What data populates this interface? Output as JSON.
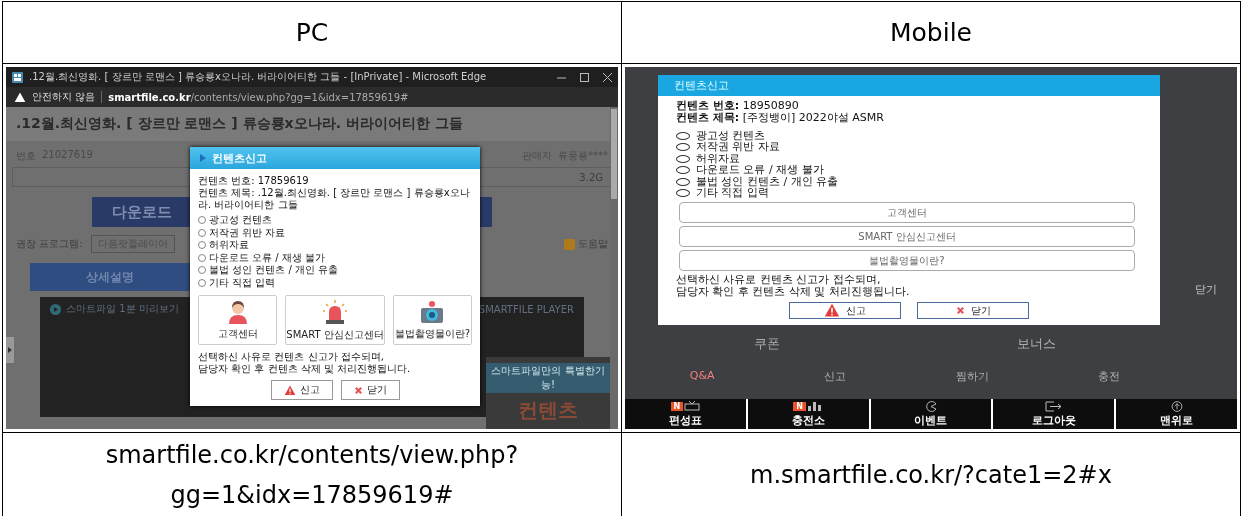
{
  "columns": [
    {
      "heading": "PC"
    },
    {
      "heading": "Mobile"
    }
  ],
  "pc": {
    "window_title": ".12월.최신영화. [ 장르만 로맨스 ] 류승룡x오나라. 버라이어티한 그들 - [InPrivate] - Microsoft Edge",
    "address_bar": {
      "warning": "안전하지 않음",
      "host": "smartfile.co.kr",
      "path": "/contents/view.php?gg=1&idx=17859619#"
    },
    "page": {
      "title": ".12월.최신영화. [ 장르만 로맨스 ] 류승룡x오나라. 버라이어티한 그들",
      "number_label": "번호",
      "number": "21027619",
      "seller_label": "판매자",
      "seller": "류풍룡****",
      "file_size": "3.2G",
      "download": "다운로드",
      "recommended_label": "권장 프로그램:",
      "player": "다음팟플레이어",
      "help": "도움말",
      "detail_tab": "상세설명",
      "preview_title": "스마트파일 1분 미리보기",
      "player_label": "SMARTFILE PLAYER",
      "promo_ribbon": "스마트파일만의 특별한기능!",
      "promo_title": "컨텐츠"
    },
    "dialog": {
      "title": "컨텐츠신고",
      "info": [
        "컨텐츠 번호: 17859619",
        "컨텐츠 제목: .12월.최신영화. [ 장르만 로맨스 ] 류승룡x오나라. 버라이어티한 그들"
      ],
      "reasons": [
        {
          "label": "광고성 컨텐츠",
          "selected": false
        },
        {
          "label": "저작권 위반 자료",
          "selected": false
        },
        {
          "label": "허위자료",
          "selected": false
        },
        {
          "label": "다운로드 오류 / 재생 불가",
          "selected": false
        },
        {
          "label": "불법 성인 컨텐츠 / 개인 유출",
          "selected": false
        },
        {
          "label": "기타 직접 입력",
          "selected": false
        }
      ],
      "links": [
        {
          "label": "고객센터",
          "kind": "person"
        },
        {
          "label": "SMART 안심신고센터",
          "kind": "siren"
        },
        {
          "label": "불법촬영물이란?",
          "kind": "camera"
        }
      ],
      "notice": [
        "선택하신 사유로 컨텐츠 신고가 접수되며,",
        "담당자 확인 후 컨텐츠 삭제 및 처리진행됩니다."
      ],
      "actions": [
        {
          "label": "신고",
          "kind": "report"
        },
        {
          "label": "닫기",
          "kind": "close"
        }
      ]
    }
  },
  "mobile": {
    "page": {
      "coupon": "쿠폰",
      "bonus": "보너스",
      "qna": "Q&A",
      "report": "신고",
      "favorite": "찜하기",
      "charge": "충전",
      "close": "닫기"
    },
    "dialog": {
      "title": "컨텐츠신고",
      "info": [
        "**컨텐츠 번호:** 18950890",
        "**컨텐츠 제목:** [주정뱅이] 2022야설 ASMR"
      ],
      "reasons": [
        {
          "label": "광고성 컨텐츠",
          "selected": false
        },
        {
          "label": "저작권 위반 자료",
          "selected": false
        },
        {
          "label": "허위자료",
          "selected": false
        },
        {
          "label": "다운로드 오류 / 재생 불가",
          "selected": false
        },
        {
          "label": "불법 성인 컨텐츠 / 개인 유출",
          "selected": false
        },
        {
          "label": "기타 직접 입력",
          "selected": false
        }
      ],
      "links": [
        {
          "label": "고객센터"
        },
        {
          "label": "SMART 안심신고센터"
        },
        {
          "label": "불법촬영물이란?"
        }
      ],
      "notice": [
        "선택하신 사유로 컨텐츠 신고가 접수되며,",
        "담당자 확인 후 컨텐츠 삭제 및 처리진행됩니다."
      ],
      "actions": [
        {
          "label": "신고",
          "kind": "report"
        },
        {
          "label": "닫기",
          "kind": "close"
        }
      ]
    },
    "nav": [
      {
        "label": "편성표",
        "kind": "tv",
        "badge": "N"
      },
      {
        "label": "충전소",
        "kind": "chart",
        "badge": "N"
      },
      {
        "label": "이벤트",
        "kind": "event"
      },
      {
        "label": "로그아웃",
        "kind": "logout"
      },
      {
        "label": "맨위로",
        "kind": "top"
      }
    ]
  },
  "captions": [
    "smartfile.co.kr/contents/view.php?gg=1&idx=17859619#",
    "m.smartfile.co.kr/?cate1=2#x"
  ]
}
